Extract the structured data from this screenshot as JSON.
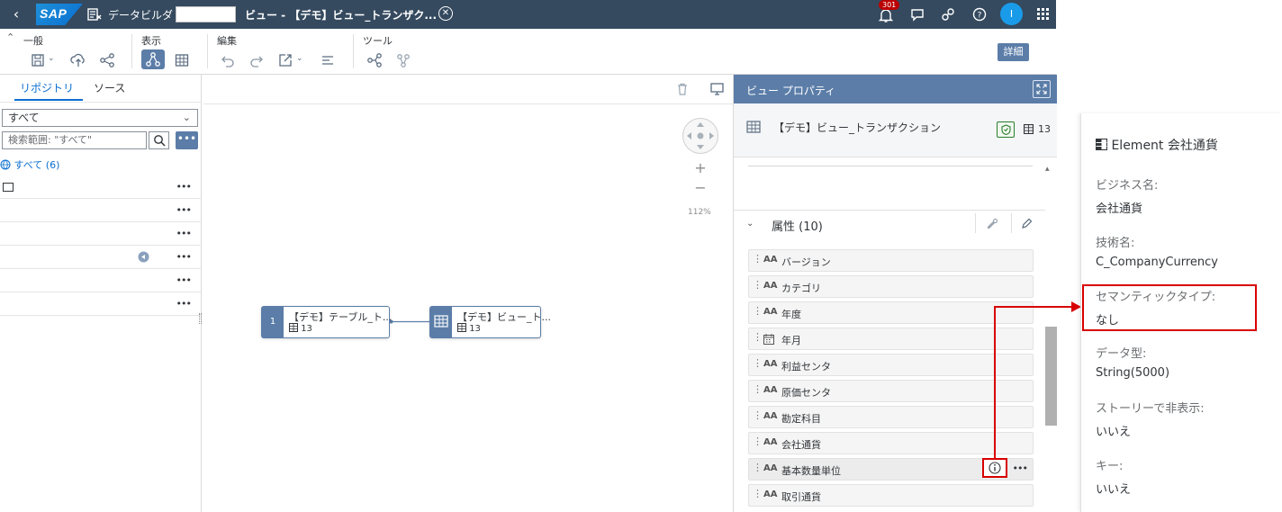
{
  "shell": {
    "app_name": "データビルダ",
    "doc_title": "ビュー - 【デモ】ビュー_トランザク...",
    "notifications": "301",
    "avatar": "I"
  },
  "toolbar": {
    "group_general": "一般",
    "group_view": "表示",
    "group_edit": "編集",
    "group_tools": "ツール",
    "detail_button": "詳細"
  },
  "left_panel": {
    "tab_repository": "リポジトリ",
    "tab_sources": "ソース",
    "filter_value": "すべて",
    "search_placeholder": "検索範囲: \"すべて\"",
    "all_label": "すべて (6)",
    "rows": [
      "",
      "",
      "",
      "",
      "",
      ""
    ],
    "row_menu": "•••",
    "more_button": "•••"
  },
  "canvas": {
    "zoom": "112%",
    "nodes": [
      {
        "index": "1",
        "title": "【デモ】テーブル_ト...",
        "count": "13"
      },
      {
        "index": "",
        "title": "【デモ】ビュー_ト...",
        "count": "13"
      }
    ]
  },
  "properties": {
    "header": "ビュー プロパティ",
    "entity_name": "【デモ】ビュー_トランザクション",
    "entity_count": "13",
    "attributes_title": "属性 (10)",
    "attributes": [
      {
        "label": "バージョン",
        "type": "text"
      },
      {
        "label": "カテゴリ",
        "type": "text"
      },
      {
        "label": "年度",
        "type": "text"
      },
      {
        "label": "年月",
        "type": "date"
      },
      {
        "label": "利益センタ",
        "type": "text"
      },
      {
        "label": "原価センタ",
        "type": "text"
      },
      {
        "label": "勘定科目",
        "type": "text"
      },
      {
        "label": "会社通貨",
        "type": "text"
      },
      {
        "label": "基本数量単位",
        "type": "text"
      },
      {
        "label": "取引通貨",
        "type": "text"
      }
    ],
    "type_text_icon": "AA",
    "row_menu": "•••"
  },
  "popover": {
    "title": "Element 会社通貨",
    "fields": [
      {
        "label": "ビジネス名:",
        "value": "会社通貨"
      },
      {
        "label": "技術名:",
        "value": "C_CompanyCurrency"
      },
      {
        "label": "セマンティックタイプ:",
        "value": "なし"
      },
      {
        "label": "データ型:",
        "value": "String(5000)"
      },
      {
        "label": "ストーリーで非表示:",
        "value": "いいえ"
      },
      {
        "label": "キー:",
        "value": "いいえ"
      }
    ]
  },
  "colors": {
    "shell": "#354a5f",
    "accent": "#5b7da8",
    "highlight": "#d80000"
  }
}
